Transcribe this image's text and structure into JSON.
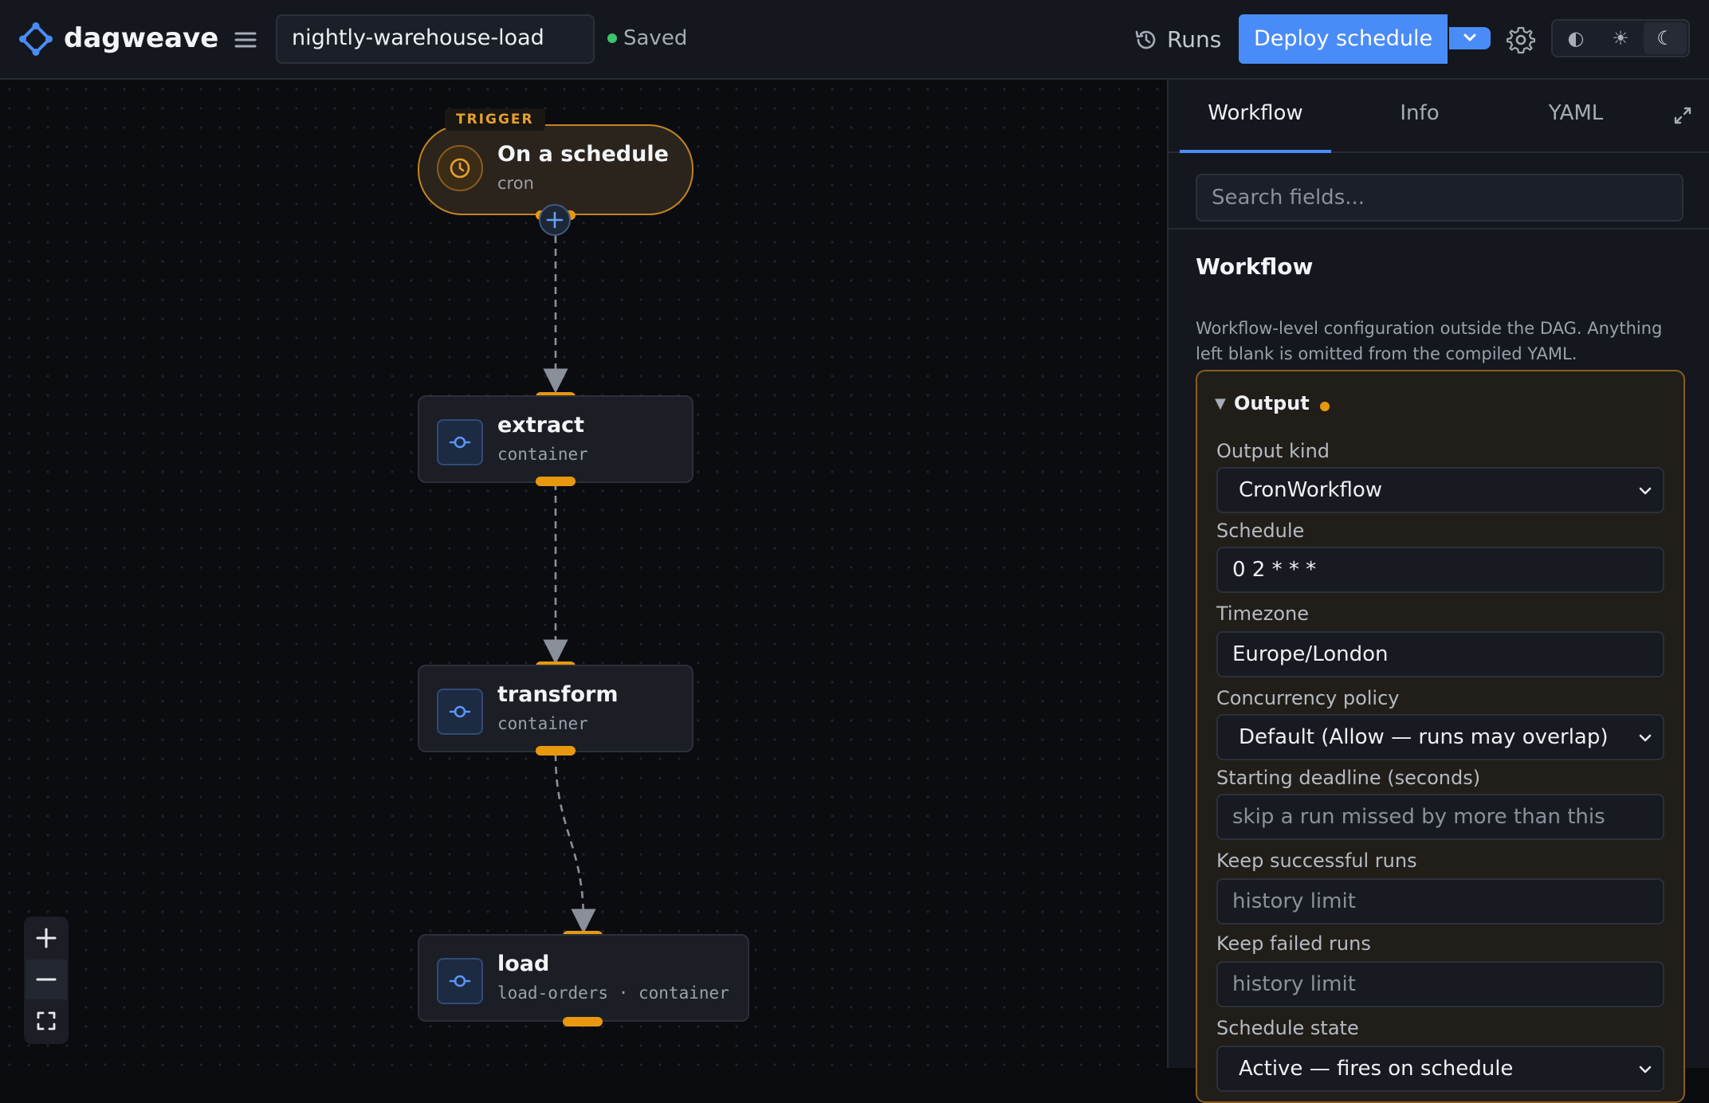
{
  "app": {
    "name": "dagweave",
    "workflow_name": "nightly-warehouse-load",
    "save_status": "Saved",
    "runs_label": "Runs",
    "deploy_label": "Deploy schedule",
    "theme_options": [
      "◐",
      "☀",
      "☾"
    ],
    "accent_color": "#4a8cf7"
  },
  "canvas": {
    "trigger_tag": "TRIGGER",
    "nodes": [
      {
        "title": "On a schedule",
        "subtitle": "cron",
        "kind": "trigger",
        "icon": "clock-icon"
      },
      {
        "title": "extract",
        "subtitle": "container",
        "kind": "task",
        "icon": "commit-icon"
      },
      {
        "title": "transform",
        "subtitle": "container",
        "kind": "task",
        "icon": "commit-icon"
      },
      {
        "title": "load",
        "subtitle": "load-orders · container",
        "kind": "task",
        "icon": "commit-icon"
      }
    ],
    "zoom_controls": [
      "zoom-in-icon",
      "zoom-out-icon",
      "fit-view-icon"
    ]
  },
  "panel": {
    "tabs": [
      "Workflow",
      "Info",
      "YAML"
    ],
    "active_tab": "Workflow",
    "search_placeholder": "Search fields...",
    "section_title": "Workflow",
    "section_description": "Workflow-level configuration outside the DAG. Anything left blank is omitted from the compiled YAML.",
    "output": {
      "title": "Output",
      "fields": [
        {
          "label": "Output kind",
          "value": "CronWorkflow",
          "type": "select"
        },
        {
          "label": "Schedule",
          "value": "0 2 * * *",
          "type": "input"
        },
        {
          "label": "Timezone",
          "value": "Europe/London",
          "type": "input"
        },
        {
          "label": "Concurrency policy",
          "value": "Default (Allow — runs may overlap)",
          "type": "select"
        },
        {
          "label": "Starting deadline (seconds)",
          "placeholder": "skip a run missed by more than this",
          "type": "input"
        },
        {
          "label": "Keep successful runs",
          "placeholder": "history limit",
          "type": "input"
        },
        {
          "label": "Keep failed runs",
          "placeholder": "history limit",
          "type": "input"
        },
        {
          "label": "Schedule state",
          "value": "Active — fires on schedule",
          "type": "select"
        }
      ]
    }
  }
}
